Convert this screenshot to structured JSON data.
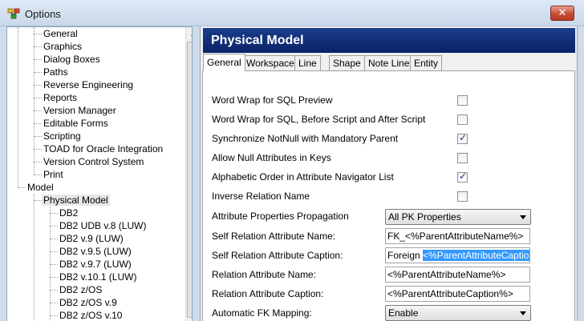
{
  "window": {
    "title": "Options",
    "close_label": "✕"
  },
  "tree": {
    "items": [
      {
        "label": "General"
      },
      {
        "label": "Graphics"
      },
      {
        "label": "Dialog Boxes"
      },
      {
        "label": "Paths"
      },
      {
        "label": "Reverse Engineering"
      },
      {
        "label": "Reports"
      },
      {
        "label": "Version Manager"
      },
      {
        "label": "Editable Forms"
      },
      {
        "label": "Scripting"
      },
      {
        "label": "TOAD for Oracle Integration"
      },
      {
        "label": "Version Control System"
      },
      {
        "label": "Print"
      },
      {
        "label": "Model"
      },
      {
        "label": "Physical Model"
      },
      {
        "label": "DB2"
      },
      {
        "label": "DB2 UDB v.8 (LUW)"
      },
      {
        "label": "DB2 v.9 (LUW)"
      },
      {
        "label": "DB2 v.9.5 (LUW)"
      },
      {
        "label": "DB2 v.9.7 (LUW)"
      },
      {
        "label": "DB2 v.10.1 (LUW)"
      },
      {
        "label": "DB2 z/OS"
      },
      {
        "label": "DB2 z/OS v.9"
      },
      {
        "label": "DB2 z/OS v.10"
      }
    ]
  },
  "panel": {
    "header": "Physical Model",
    "tabs": [
      "General",
      "Workspace",
      "Line",
      "Shape",
      "Note Line",
      "Entity"
    ],
    "checkbox_options": [
      {
        "label": "Word Wrap for SQL Preview",
        "checked": false
      },
      {
        "label": "Word Wrap for SQL, Before Script and After Script",
        "checked": false
      },
      {
        "label": "Synchronize NotNull with Mandatory Parent",
        "checked": true
      },
      {
        "label": "Allow Null Attributes in Keys",
        "checked": false
      },
      {
        "label": "Alphabetic Order in Attribute Navigator List",
        "checked": true
      },
      {
        "label": "Inverse Relation Name",
        "checked": false
      }
    ],
    "fields": {
      "propagation_label": "Attribute Properties Propagation",
      "propagation_value": "All PK Properties",
      "self_name_label": "Self Relation Attribute Name:",
      "self_name_value": "FK_<%ParentAttributeName%>",
      "self_caption_label": "Self Relation Attribute Caption:",
      "self_caption_prefix": "Foreign ",
      "self_caption_selected": "<%ParentAttributeCaption%>",
      "rel_name_label": "Relation Attribute Name:",
      "rel_name_value": "<%ParentAttributeName%>",
      "rel_caption_label": "Relation Attribute Caption:",
      "rel_caption_value": "<%ParentAttributeCaption%>",
      "fk_mapping_label": "Automatic FK Mapping:",
      "fk_mapping_value": "Enable"
    }
  }
}
